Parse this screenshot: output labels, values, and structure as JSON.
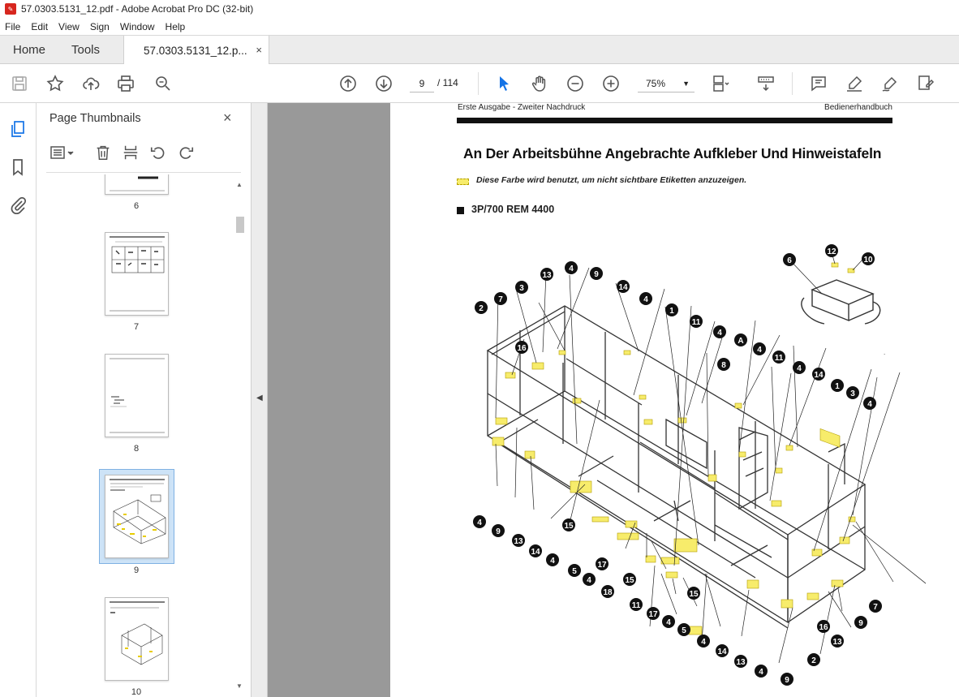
{
  "window": {
    "title": "57.0303.5131_12.pdf - Adobe Acrobat Pro DC (32-bit)"
  },
  "menu": [
    "File",
    "Edit",
    "View",
    "Sign",
    "Window",
    "Help"
  ],
  "tabs": {
    "home": "Home",
    "tools": "Tools",
    "document": "57.0303.5131_12.p...",
    "close": "×"
  },
  "toolbar": {
    "page_current": "9",
    "page_total": "/ 114",
    "zoom": "75%"
  },
  "thumbnails": {
    "title": "Page Thumbnails",
    "close": "×",
    "pages": [
      "6",
      "7",
      "8",
      "9",
      "10"
    ],
    "selected_page": "9"
  },
  "document": {
    "header_left": "Erste Ausgabe - Zweiter Nachdruck",
    "header_right": "Bedienerhandbuch",
    "title": "An Der Arbeitsbühne Angebrachte Aufkleber Und Hinweistafeln",
    "legend_text": "Diese Farbe wird benutzt, um nicht sichtbare Etiketten anzuzeigen.",
    "section_title": "3P/700 REM 4400",
    "label_color": "#f7ec6b",
    "callouts": [
      "6",
      "12",
      "10",
      "13",
      "4",
      "9",
      "3",
      "7",
      "14",
      "4",
      "2",
      "1",
      "11",
      "16",
      "4",
      "A",
      "4",
      "8",
      "11",
      "4",
      "14",
      "1",
      "3",
      "4",
      "4",
      "9",
      "13",
      "14",
      "4",
      "15",
      "5",
      "4",
      "17",
      "18",
      "15",
      "11",
      "17",
      "4",
      "5",
      "15",
      "4",
      "14",
      "13",
      "4",
      "9",
      "2",
      "16",
      "13",
      "9",
      "7"
    ]
  }
}
